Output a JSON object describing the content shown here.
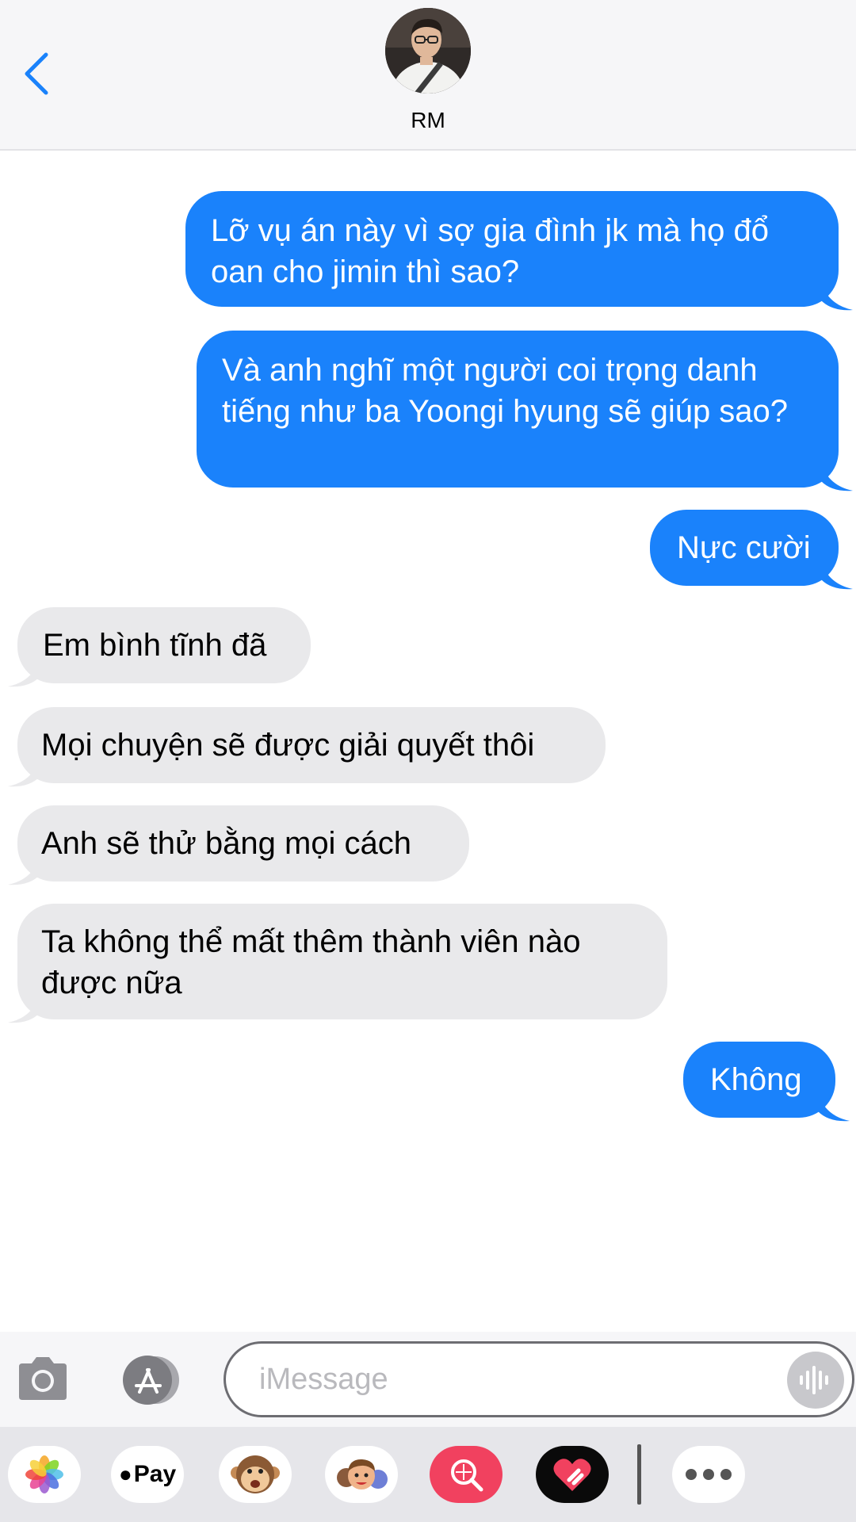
{
  "header": {
    "contact_name": "RM"
  },
  "messages": [
    {
      "direction": "sent",
      "text": "Lỡ vụ án này vì sợ gia đình jk mà họ đổ oan cho jimin thì sao?"
    },
    {
      "direction": "sent",
      "text": "Và anh nghĩ một người coi trọng danh tiếng như ba Yoongi hyung sẽ giúp sao?"
    },
    {
      "direction": "sent",
      "text": "Nực cười"
    },
    {
      "direction": "received",
      "text": "Em bình tĩnh đã"
    },
    {
      "direction": "received",
      "text": "Mọi chuyện sẽ được giải quyết thôi"
    },
    {
      "direction": "received",
      "text": "Anh sẽ thử bằng mọi cách"
    },
    {
      "direction": "received",
      "text": "Ta không thể mất thêm thành viên nào được nữa"
    },
    {
      "direction": "sent",
      "text": "Không"
    }
  ],
  "input": {
    "placeholder": "iMessage"
  },
  "app_drawer": {
    "apple_pay_label": "Pay",
    "apps": [
      "photos-icon",
      "apple-pay-icon",
      "animoji-icon",
      "memoji-icon",
      "web-search-icon",
      "digital-touch-icon",
      "more-icon"
    ]
  },
  "colors": {
    "sent_bubble": "#1a82fb",
    "received_bubble": "#e9e9eb",
    "accent": "#1a82fb"
  }
}
